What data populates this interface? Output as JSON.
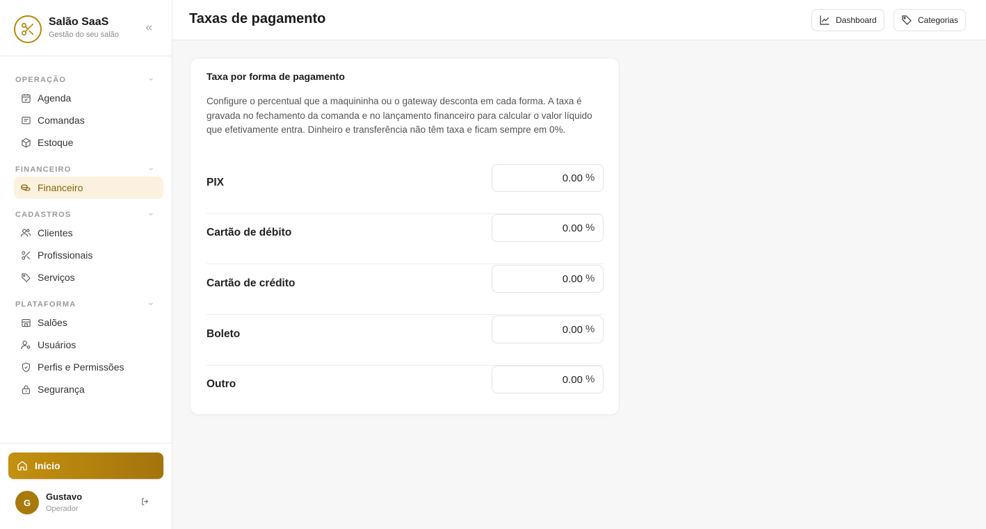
{
  "brand": {
    "title": "Salão SaaS",
    "subtitle": "Gestão do seu salão"
  },
  "nav": {
    "sections": [
      {
        "title": "OPERAÇÃO",
        "items": [
          {
            "label": "Agenda",
            "icon": "calendar-icon"
          },
          {
            "label": "Comandas",
            "icon": "receipt-icon"
          },
          {
            "label": "Estoque",
            "icon": "package-icon"
          }
        ]
      },
      {
        "title": "FINANCEIRO",
        "items": [
          {
            "label": "Financeiro",
            "icon": "coins-icon",
            "active": true
          }
        ]
      },
      {
        "title": "CADASTROS",
        "items": [
          {
            "label": "Clientes",
            "icon": "users-icon"
          },
          {
            "label": "Profissionais",
            "icon": "scissors-icon"
          },
          {
            "label": "Serviços",
            "icon": "tag-icon"
          }
        ]
      },
      {
        "title": "PLATAFORMA",
        "items": [
          {
            "label": "Salões",
            "icon": "store-icon"
          },
          {
            "label": "Usuários",
            "icon": "user-cog-icon"
          },
          {
            "label": "Perfis e Permissões",
            "icon": "shield-icon"
          },
          {
            "label": "Segurança",
            "icon": "lock-icon"
          }
        ]
      }
    ]
  },
  "sidebar_bottom": {
    "home_label": "Início",
    "user": {
      "initial": "G",
      "name": "Gustavo",
      "role": "Operador"
    }
  },
  "header": {
    "title": "Taxas de pagamento",
    "buttons": {
      "dashboard": "Dashboard",
      "categories": "Categorias"
    }
  },
  "card": {
    "title": "Taxa por forma de pagamento",
    "description": "Configure o percentual que a maquininha ou o gateway desconta em cada forma. A taxa é gravada no fechamento da comanda e no lançamento financeiro para calcular o valor líquido que efetivamente entra. Dinheiro e transferência não têm taxa e ficam sempre em 0%.",
    "unit": "%",
    "rows": [
      {
        "label": "PIX",
        "value": "0.00"
      },
      {
        "label": "Cartão de débito",
        "value": "0.00"
      },
      {
        "label": "Cartão de crédito",
        "value": "0.00"
      },
      {
        "label": "Boleto",
        "value": "0.00"
      },
      {
        "label": "Outro",
        "value": "0.00"
      }
    ]
  },
  "colors": {
    "accent": "#b8860b",
    "active_bg": "#fbf1de",
    "active_text": "#8a6308"
  }
}
